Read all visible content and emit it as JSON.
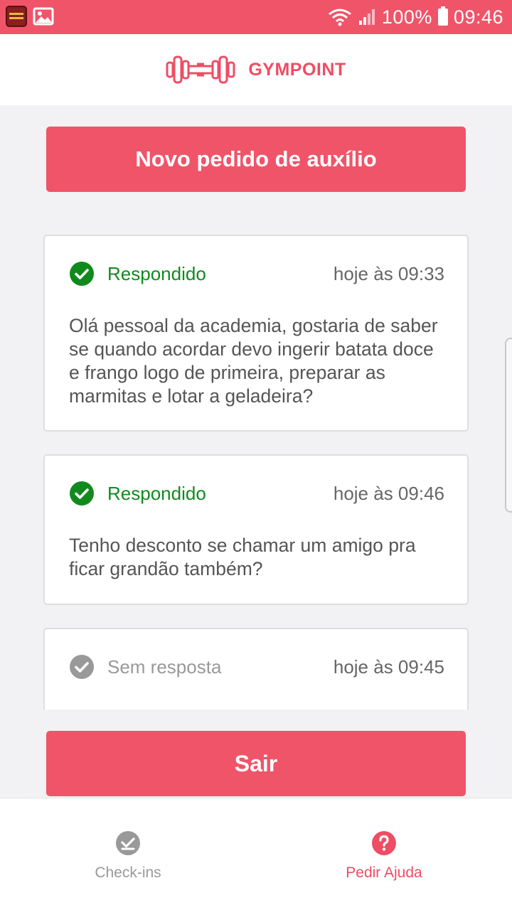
{
  "status_bar": {
    "battery": "100%",
    "time": "09:46"
  },
  "header": {
    "brand": "GYMPOINT"
  },
  "new_request_button": "Novo pedido de auxílio",
  "help_orders": [
    {
      "status": "Respondido",
      "answered": true,
      "time": "hoje às 09:33",
      "question": "Olá pessoal da academia, gostaria de saber se quando acordar devo ingerir batata doce e frango logo de primeira, preparar as marmitas e lotar a geladeira?"
    },
    {
      "status": "Respondido",
      "answered": true,
      "time": "hoje às 09:46",
      "question": "Tenho desconto se chamar um amigo pra ficar grandão também?"
    },
    {
      "status": "Sem resposta",
      "answered": false,
      "time": "hoje às 09:45"
    }
  ],
  "logout_button": "Sair",
  "bottom_nav": [
    {
      "label": "Check-ins",
      "icon": "check-circle-icon",
      "active": false
    },
    {
      "label": "Pedir Ajuda",
      "icon": "question-circle-icon",
      "active": true
    }
  ],
  "colors": {
    "primary": "#ee4d64",
    "answered": "#118a1d",
    "pending": "#999999"
  }
}
